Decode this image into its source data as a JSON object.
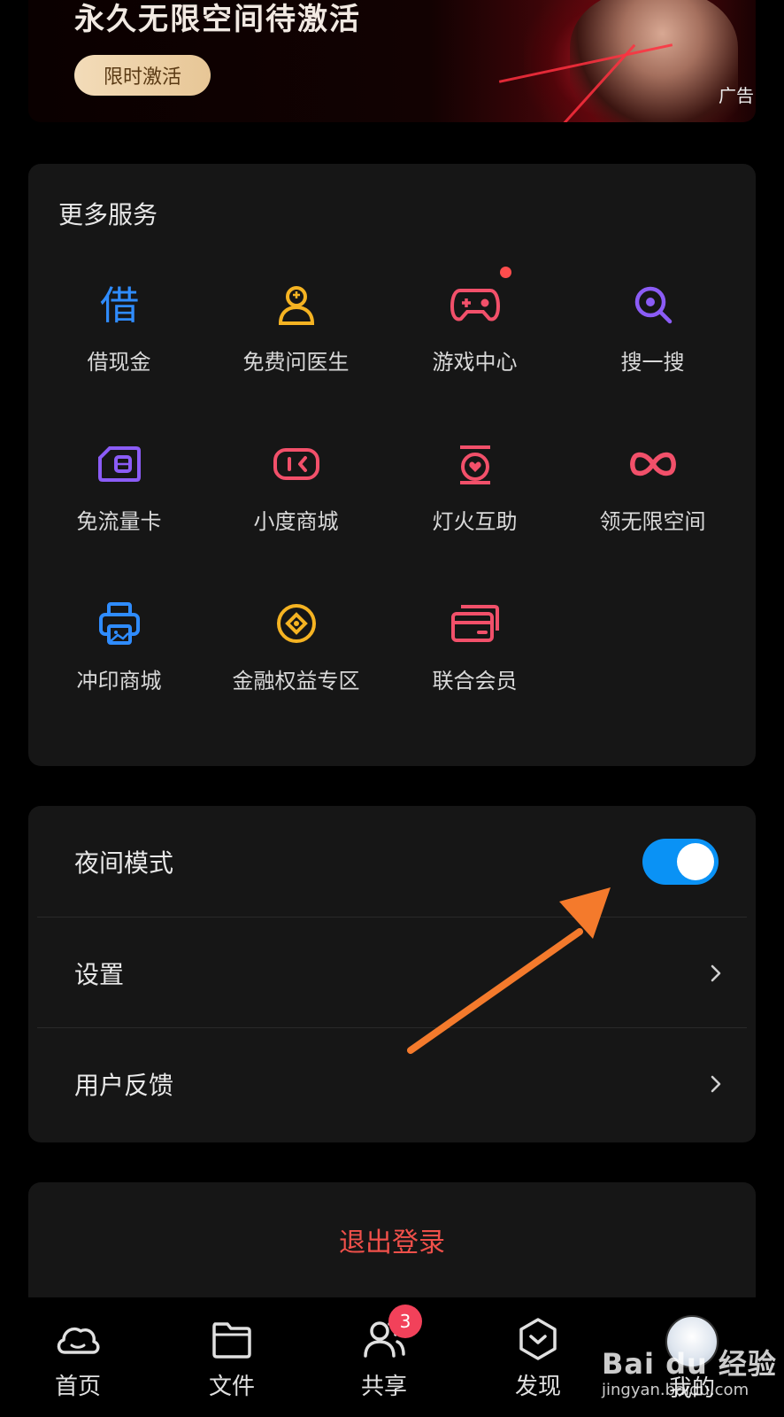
{
  "ad": {
    "headline": "永久无限空间待激活",
    "cta": "限时激活",
    "label": "广告"
  },
  "services": {
    "title": "更多服务",
    "items": [
      {
        "label": "借现金",
        "icon": "borrow-cash-icon",
        "color": "#2f8cff"
      },
      {
        "label": "免费问医生",
        "icon": "doctor-icon",
        "color": "#f5b322"
      },
      {
        "label": "游戏中心",
        "icon": "gamepad-icon",
        "color": "#f2506a"
      },
      {
        "label": "搜一搜",
        "icon": "search-icon",
        "color": "#8b5cf6"
      },
      {
        "label": "免流量卡",
        "icon": "sim-card-icon",
        "color": "#8b5cf6"
      },
      {
        "label": "小度商城",
        "icon": "xiaodu-icon",
        "color": "#f2506a"
      },
      {
        "label": "灯火互助",
        "icon": "mutual-aid-icon",
        "color": "#f2506a"
      },
      {
        "label": "领无限空间",
        "icon": "infinity-icon",
        "color": "#f2506a"
      },
      {
        "label": "冲印商城",
        "icon": "printer-icon",
        "color": "#2f8cff"
      },
      {
        "label": "金融权益专区",
        "icon": "coin-icon",
        "color": "#f5b322"
      },
      {
        "label": "联合会员",
        "icon": "member-card-icon",
        "color": "#f2506a"
      }
    ]
  },
  "settings": {
    "night_mode_label": "夜间模式",
    "night_mode_on": true,
    "settings_label": "设置",
    "feedback_label": "用户反馈"
  },
  "logout": {
    "label": "退出登录"
  },
  "colors": {
    "accent": "#0a92f5",
    "danger": "#f0504a",
    "annotation": "#f47a2c"
  },
  "nav": {
    "tabs": [
      {
        "label": "首页",
        "icon": "home-cloud-icon"
      },
      {
        "label": "文件",
        "icon": "folder-icon"
      },
      {
        "label": "共享",
        "icon": "share-users-icon",
        "badge": "3"
      },
      {
        "label": "发现",
        "icon": "discover-icon"
      },
      {
        "label": "我的",
        "icon": "avatar"
      }
    ]
  },
  "watermark": {
    "logo": "Bai du 经验",
    "url": "jingyan.baidu.com"
  }
}
